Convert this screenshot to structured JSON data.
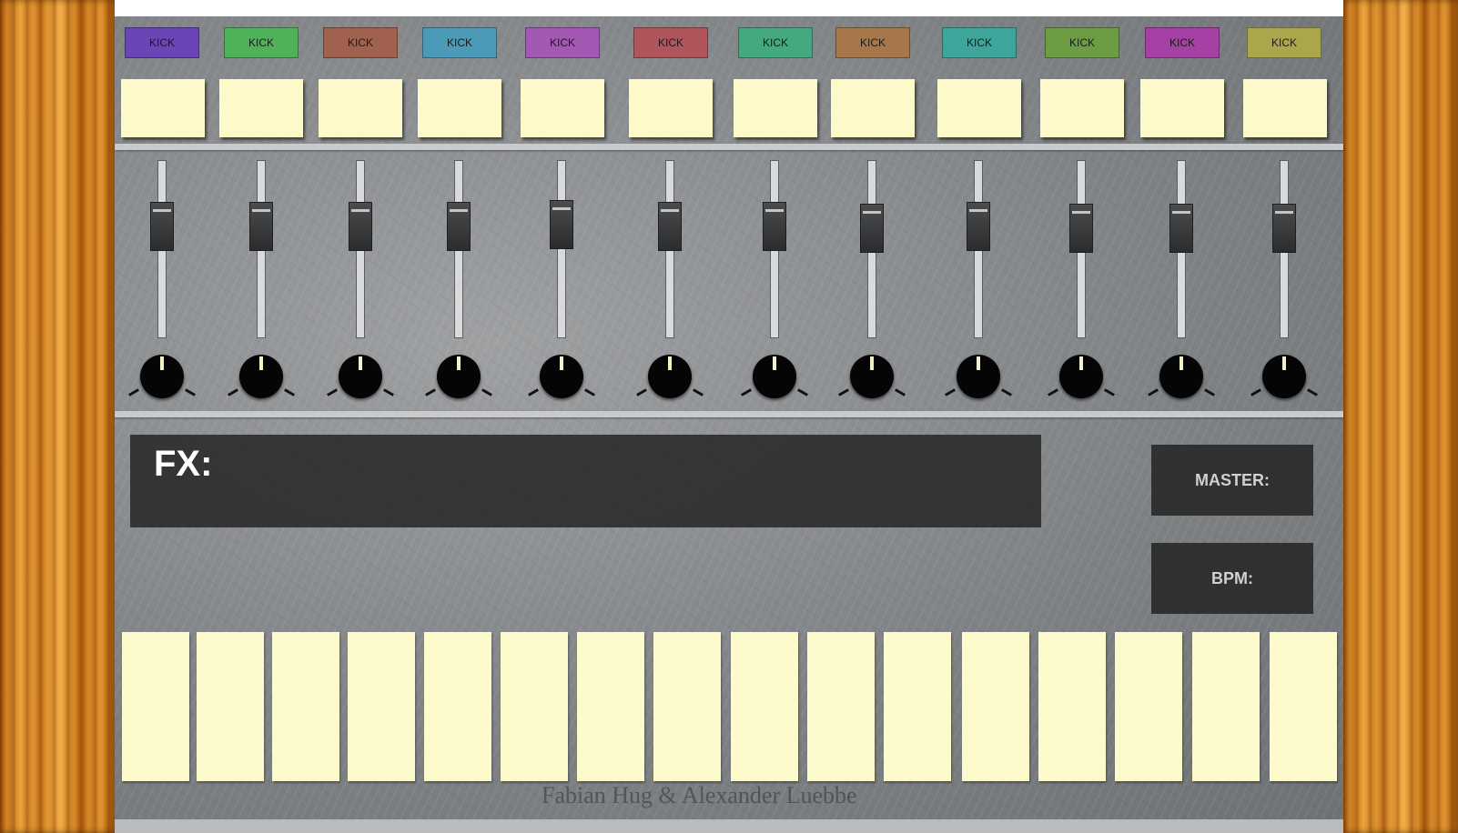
{
  "tracks": [
    {
      "label": "KICK",
      "color": "#6a45b5"
    },
    {
      "label": "KICK",
      "color": "#4fb25a"
    },
    {
      "label": "KICK",
      "color": "#a0614f"
    },
    {
      "label": "KICK",
      "color": "#4a9ab8"
    },
    {
      "label": "KICK",
      "color": "#a358b4"
    },
    {
      "label": "KICK",
      "color": "#b0555c"
    },
    {
      "label": "KICK",
      "color": "#45a97f"
    },
    {
      "label": "KICK",
      "color": "#a5774a"
    },
    {
      "label": "KICK",
      "color": "#3ea59a"
    },
    {
      "label": "KICK",
      "color": "#6c9c44"
    },
    {
      "label": "KICK",
      "color": "#a541a4"
    },
    {
      "label": "KICK",
      "color": "#a9a64b"
    }
  ],
  "fx": {
    "label": "FX:"
  },
  "master": {
    "label": "MASTER:"
  },
  "bpm": {
    "label": "BPM:"
  },
  "steps": {
    "count": 16
  },
  "credits": "Fabian Hug & Alexander Luebbe"
}
